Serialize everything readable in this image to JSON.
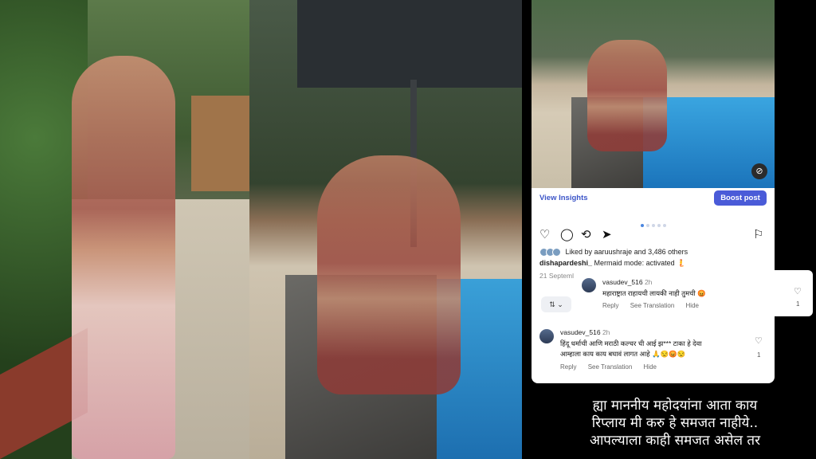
{
  "left_photos": [
    {
      "description_icon": "photo-garden"
    },
    {
      "description_icon": "photo-pool"
    }
  ],
  "post": {
    "view_insights_label": "View Insights",
    "boost_label": "Boost post",
    "liked_by_text": "Liked by aaruushraje and 3,486 others",
    "caption_user": "dishapardeshi_",
    "caption_text": "Mermaid mode: activated",
    "date": "21 Septeml",
    "carousel_dots": 5
  },
  "comments": [
    {
      "user": "vasudev_516",
      "time": "2h",
      "text": "महाराष्ट्रात राहायची लायकी नाही तुमची 😡",
      "reply_label": "Reply",
      "translate_label": "See Translation",
      "hide_label": "Hide",
      "likes": "1"
    },
    {
      "user": "vasudev_516",
      "time": "2h",
      "text_line1": "हिंदू धर्माची आणि मराठी कल्चर ची आई झ*** टाका हे देवा",
      "text_line2": "आम्हाला काय काय बघावं लागत आहे 🙏😒😡😒",
      "reply_label": "Reply",
      "translate_label": "See Translation",
      "hide_label": "Hide",
      "likes": "1"
    }
  ],
  "sort_label": "⇅ ⌄",
  "story_text": {
    "line1": "ह्या माननीय महोदयांना आता काय",
    "line2": "रिप्लाय मी करु हे समजत नाहीये..",
    "line3": "आपल्याला काही समजत असेल तर"
  }
}
